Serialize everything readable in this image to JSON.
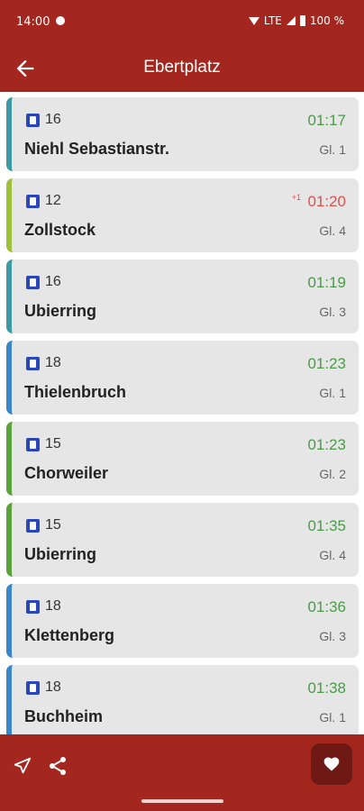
{
  "status_bar": {
    "time": "14:00",
    "network": "LTE",
    "battery": "100 %"
  },
  "app_bar": {
    "title": "Ebertplatz"
  },
  "colors": {
    "primary": "#a3261f",
    "on_time": "#4c9a4a",
    "late": "#d9534f",
    "tram_badge": "#2b46b8"
  },
  "departures": [
    {
      "line": "16",
      "destination": "Niehl Sebastianstr.",
      "time": "01:17",
      "delay": "",
      "platform": "Gl. 1",
      "accent": "#3d9aa3",
      "late": false
    },
    {
      "line": "12",
      "destination": "Zollstock",
      "time": "01:20",
      "delay": "+1",
      "platform": "Gl. 4",
      "accent": "#9fc13a",
      "late": true
    },
    {
      "line": "16",
      "destination": "Ubierring",
      "time": "01:19",
      "delay": "",
      "platform": "Gl. 3",
      "accent": "#3d9aa3",
      "late": false
    },
    {
      "line": "18",
      "destination": "Thielenbruch",
      "time": "01:23",
      "delay": "",
      "platform": "Gl. 1",
      "accent": "#3a86c8",
      "late": false
    },
    {
      "line": "15",
      "destination": "Chorweiler",
      "time": "01:23",
      "delay": "",
      "platform": "Gl. 2",
      "accent": "#5aa33c",
      "late": false
    },
    {
      "line": "15",
      "destination": "Ubierring",
      "time": "01:35",
      "delay": "",
      "platform": "Gl. 4",
      "accent": "#5aa33c",
      "late": false
    },
    {
      "line": "18",
      "destination": "Klettenberg",
      "time": "01:36",
      "delay": "",
      "platform": "Gl. 3",
      "accent": "#3a86c8",
      "late": false
    },
    {
      "line": "18",
      "destination": "Buchheim",
      "time": "01:38",
      "delay": "",
      "platform": "Gl. 1",
      "accent": "#3a86c8",
      "late": false
    }
  ],
  "bottom_bar": {
    "icons": [
      "navigation-icon",
      "share-icon",
      "heart-icon"
    ]
  }
}
